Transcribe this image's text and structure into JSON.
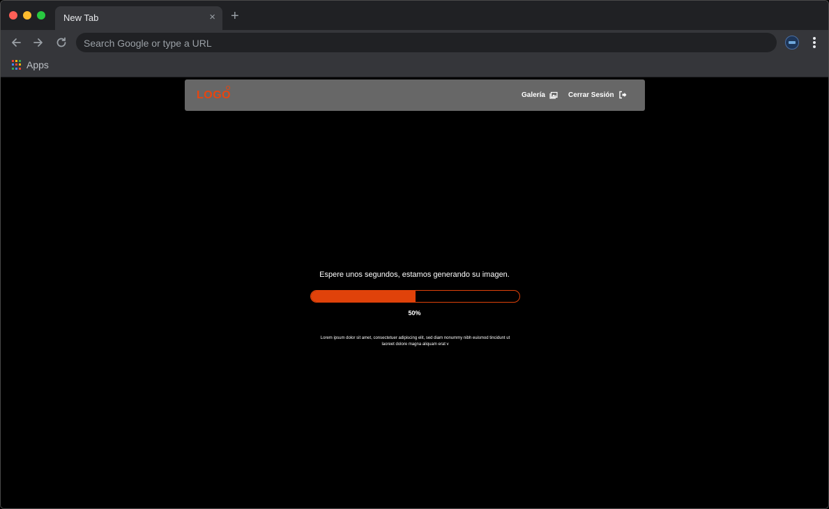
{
  "browser": {
    "tab_title": "New Tab",
    "tab_close": "×",
    "new_tab": "+",
    "omnibox_placeholder": "Search Google or type a URL",
    "bookmarks": {
      "apps_label": "Apps"
    },
    "apps_colors": [
      "#ea4335",
      "#fbbc05",
      "#34a853",
      "#4285f4",
      "#ea4335",
      "#fbbc05",
      "#34a853",
      "#4285f4",
      "#ea4335"
    ]
  },
  "site": {
    "logo": "LOGO",
    "nav": {
      "galeria": "Galería",
      "logout": "Cerrar Sesión"
    },
    "loading": {
      "message": "Espere unos segundos, estamos generando su imagen.",
      "progress": 0.5,
      "progress_label": "50%",
      "description": "Lorem ipsum dolor sit amet, consectetuer adipiscing elit, sed diam nonummy nibh euismod tincidunt ut laoreet dolore magna aliquam erat v"
    },
    "accent_color": "#e0420a"
  }
}
